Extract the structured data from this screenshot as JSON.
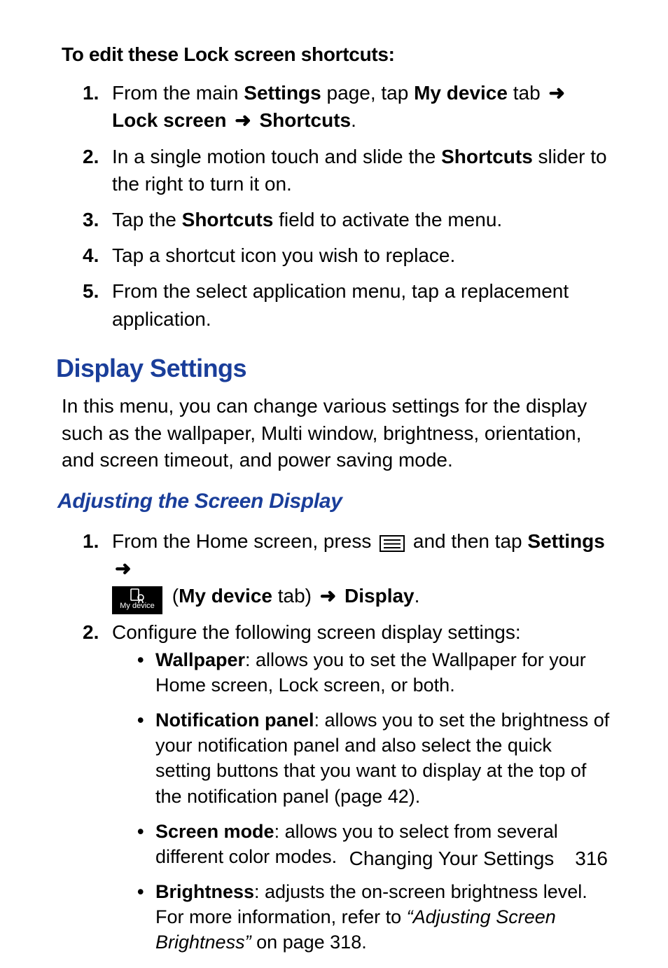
{
  "intro_heading": "To edit these Lock screen shortcuts:",
  "steps_a": {
    "s1a": "From the main ",
    "s1b": "Settings",
    "s1c": " page, tap ",
    "s1d": "My device",
    "s1e": " tab ",
    "s1f": "Lock screen",
    "s1g": "Shortcuts",
    "s1h": ".",
    "s2a": "In a single motion touch and slide the ",
    "s2b": "Shortcuts",
    "s2c": " slider to the right to turn it on.",
    "s3a": "Tap the ",
    "s3b": "Shortcuts",
    "s3c": " field to activate the menu.",
    "s4": "Tap a shortcut icon you wish to replace.",
    "s5": "From the select application menu, tap a replacement application."
  },
  "section_heading": "Display Settings",
  "section_body": "In this menu, you can change various settings for the display such as the wallpaper, Multi window, brightness, orientation, and screen timeout, and power saving mode.",
  "subsection_heading": "Adjusting the Screen Display",
  "steps_b": {
    "s1a": "From the Home screen, press ",
    "s1b": " and then tap ",
    "s1c": "Settings",
    "s1d": " (",
    "s1e": "My device",
    "s1f": " tab) ",
    "s1g": "Display",
    "s1h": ".",
    "s2": "Configure the following screen display settings:"
  },
  "mydevice_label": "My device",
  "bullets": {
    "b1_label": "Wallpaper",
    "b1_text": ": allows you to set the Wallpaper for your Home screen, Lock screen, or both.",
    "b2_label": "Notification panel",
    "b2_text": ": allows you to set the brightness of your notification panel and also select the quick setting buttons that you want to display at the top of the notification panel (page 42).",
    "b3_label": "Screen mode",
    "b3_text": ": allows you to select from several different color modes.",
    "b4_label": "Brightness",
    "b4_text_a": ": adjusts the on-screen brightness level. For more information, refer to ",
    "b4_text_b": "“Adjusting Screen Brightness”",
    "b4_text_c": " on page 318."
  },
  "arrow_glyph": "➜",
  "footer_text": "Changing Your Settings",
  "footer_page": "316"
}
